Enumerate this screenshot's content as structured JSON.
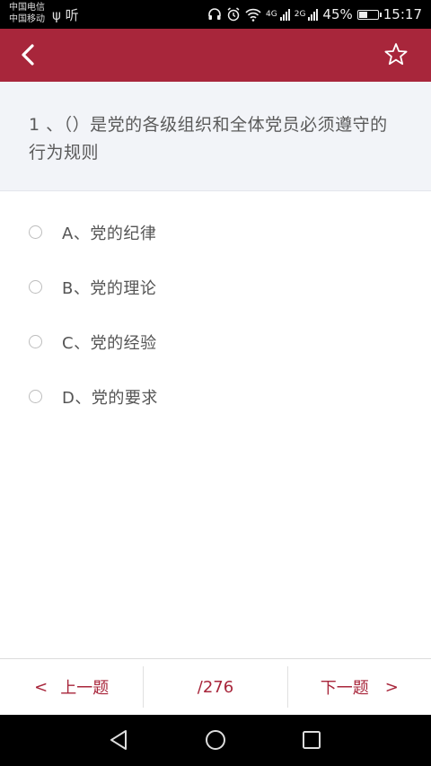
{
  "status_bar": {
    "carrier_1": "中国电信",
    "carrier_2": "中国移动",
    "left_icons": "ψ 听",
    "network_1": "4G",
    "network_2": "2G",
    "battery": "45%",
    "battery_level": 0.45,
    "time": "15:17"
  },
  "header": {
    "accent": "#a8263b"
  },
  "question": {
    "text": "1 、（）是党的各级组织和全体党员必须遵守的行为规则"
  },
  "options": [
    {
      "label": "A、党的纪律"
    },
    {
      "label": "B、党的理论"
    },
    {
      "label": "C、党的经验"
    },
    {
      "label": "D、党的要求"
    }
  ],
  "pager": {
    "prev_arrow": "<",
    "prev_label": "上一题",
    "page_count": "/276",
    "next_label": "下一题",
    "next_arrow": ">"
  }
}
